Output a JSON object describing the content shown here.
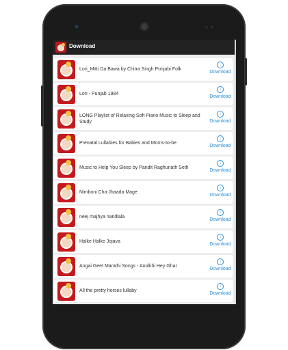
{
  "app": {
    "title": "Download",
    "icon": "lullaby-app-icon"
  },
  "colors": {
    "accent": "#2f8ed8",
    "action_bar": "#222222",
    "thumbnail": "#c41a1e"
  },
  "download_label": "Download",
  "items": [
    {
      "title": "Lori_Mitti Da Bawa by Chitra Singh Punjabi Folk",
      "action": "Download"
    },
    {
      "title": "Lori - Punjab 1984",
      "action": "Download"
    },
    {
      "title": "LONG Playlist of Relaxing Soft Piano Music to Sleep and Study",
      "action": "Download"
    },
    {
      "title": "Prenatal Lullabies for Babies and Moms-to-be",
      "action": "Download"
    },
    {
      "title": "Music to Help You Sleep by Pandit Raghunath Seth",
      "action": "Download"
    },
    {
      "title": "Nimboni Cha Jhaada Mage",
      "action": "Download"
    },
    {
      "title": "neej majhya nandlala",
      "action": "Download"
    },
    {
      "title": "Halke Halke Jojava",
      "action": "Download"
    },
    {
      "title": "Angai Geet Marathi Songs - Anolkhi Hey Ghar",
      "action": "Download"
    },
    {
      "title": "All the pretty horses lullaby",
      "action": "Download"
    }
  ]
}
